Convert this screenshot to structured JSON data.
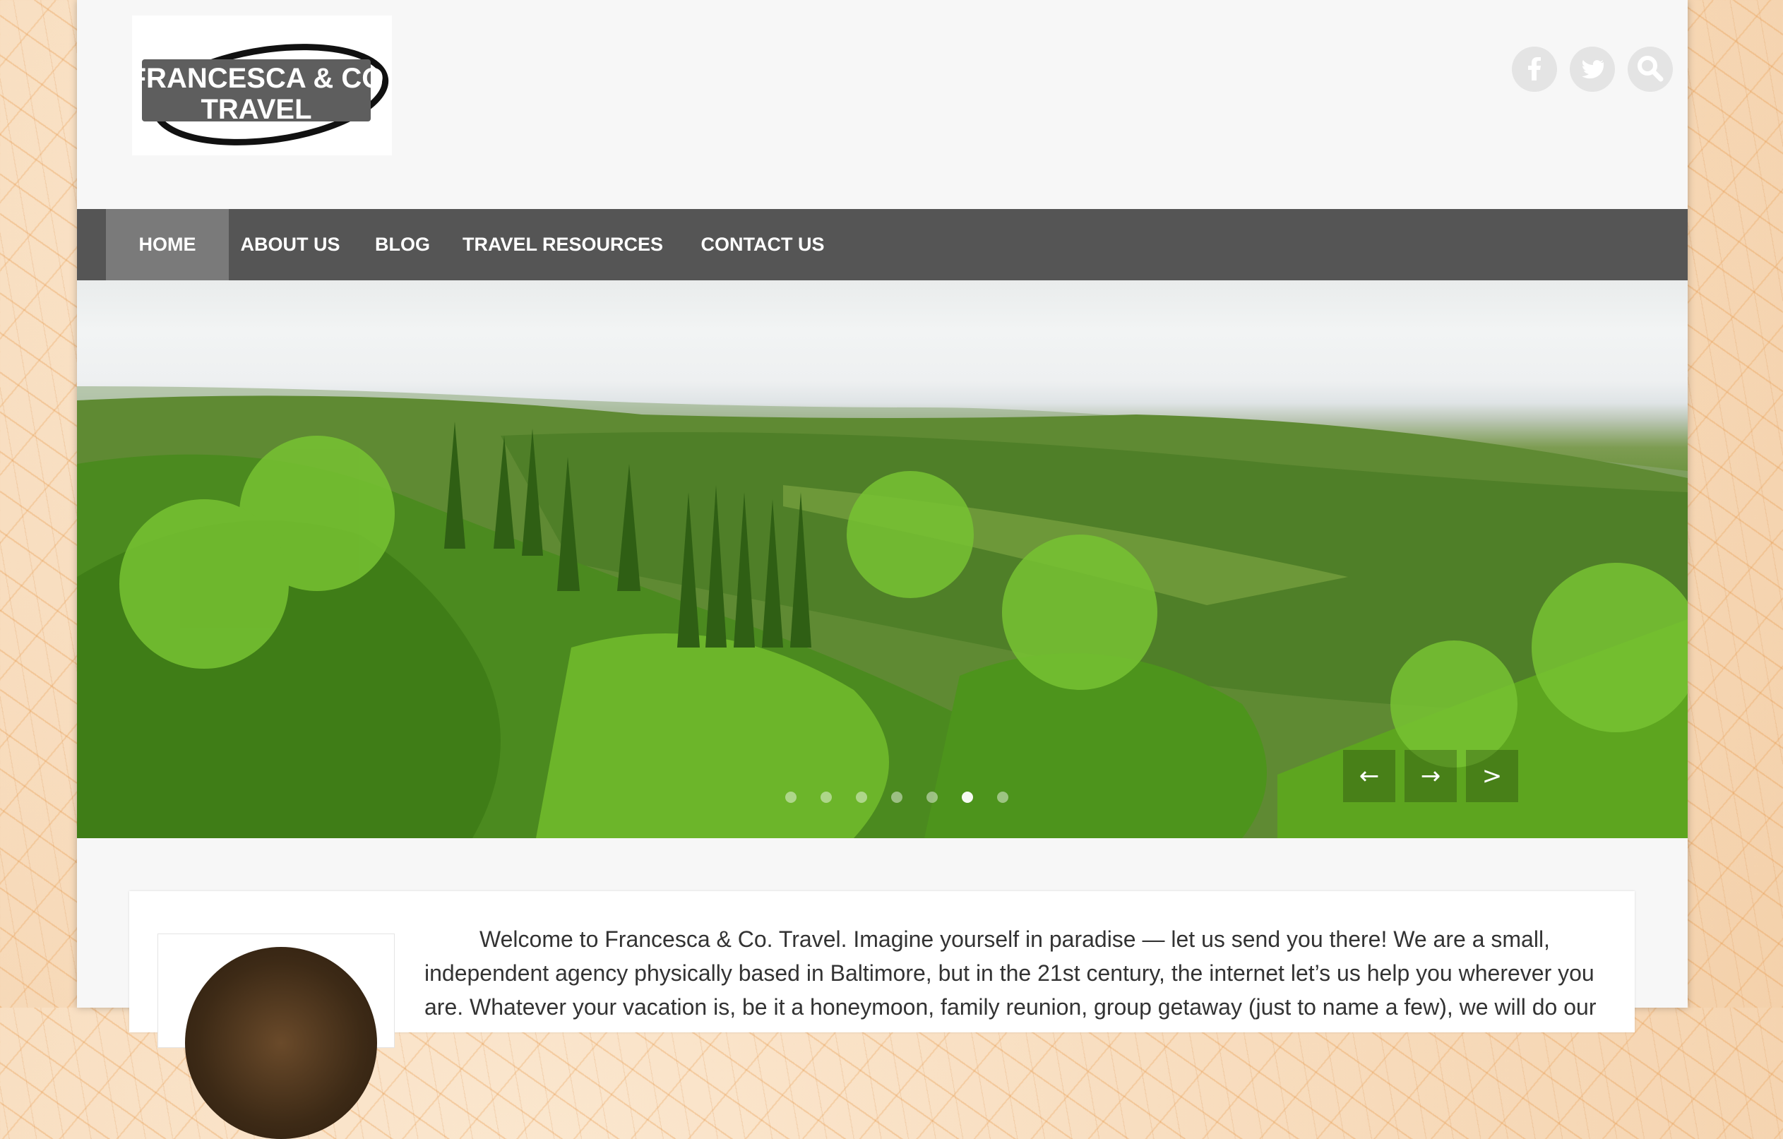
{
  "logo": {
    "line1": "FRANCESCA & CO",
    "line2": "TRAVEL"
  },
  "social": [
    {
      "name": "facebook",
      "icon": "facebook-icon"
    },
    {
      "name": "twitter",
      "icon": "twitter-icon"
    },
    {
      "name": "search",
      "icon": "search-icon"
    }
  ],
  "nav": {
    "items": [
      {
        "label": "HOME",
        "active": true
      },
      {
        "label": "ABOUT US"
      },
      {
        "label": "BLOG"
      },
      {
        "label": "TRAVEL RESOURCES"
      },
      {
        "label": "CONTACT US"
      }
    ]
  },
  "slider": {
    "prev_label": "←",
    "next_label": "→",
    "forward_label": ">",
    "dots": [
      false,
      false,
      false,
      false,
      false,
      true,
      false
    ]
  },
  "content": {
    "welcome": "Welcome to Francesca & Co. Travel.  Imagine yourself in paradise — let us send you there!  We are a small, independent agency physically based in Baltimore, but in the 21st century, the internet let’s us help you wherever you are.  Whatever your vacation is, be it a honeymoon, family reunion, group getaway (just to name a few), we will do our"
  },
  "colors": {
    "nav_bg": "#555555",
    "nav_active_bg": "#7a7a7a",
    "page_bg": "#f7f7f7",
    "social_bg": "#e4e4e4"
  }
}
